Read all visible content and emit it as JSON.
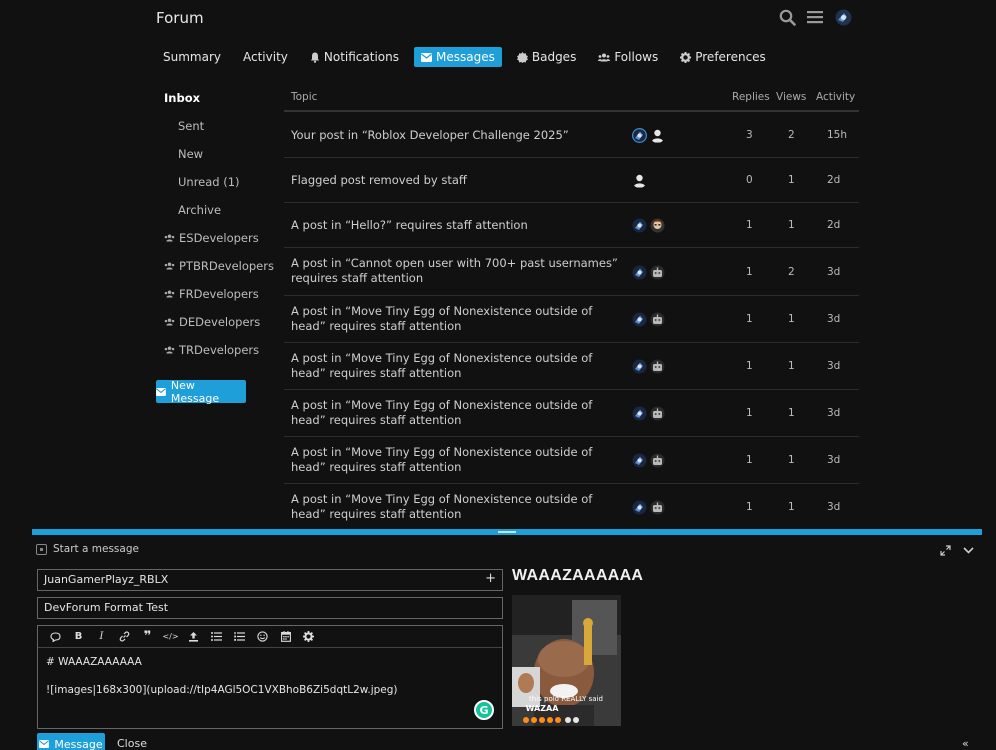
{
  "header": {
    "site_title": "Forum",
    "icons": [
      "search-icon",
      "hamburger-menu-icon",
      "user-avatar"
    ]
  },
  "user_nav": {
    "items": [
      {
        "label": "Summary",
        "icon": ""
      },
      {
        "label": "Activity",
        "icon": ""
      },
      {
        "label": "Notifications",
        "icon": "bell-icon"
      },
      {
        "label": "Messages",
        "icon": "envelope-icon",
        "active": true
      },
      {
        "label": "Badges",
        "icon": "badge-icon"
      },
      {
        "label": "Follows",
        "icon": "users-icon"
      },
      {
        "label": "Preferences",
        "icon": "gear-icon"
      }
    ]
  },
  "sidebar": {
    "inbox": "Inbox",
    "sub_items": [
      "Sent",
      "New",
      "Unread (1)",
      "Archive"
    ],
    "groups": [
      "ESDevelopers",
      "PTBRDevelopers",
      "FRDevelopers",
      "DEDevelopers",
      "TRDevelopers"
    ],
    "new_message_label": "New Message"
  },
  "topics": {
    "columns": {
      "topic": "Topic",
      "replies": "Replies",
      "views": "Views",
      "activity": "Activity"
    },
    "rows": [
      {
        "title": "Your post in “Roblox Developer Challenge 2025”",
        "replies": "3",
        "views": "2",
        "activity": "15h"
      },
      {
        "title": "Flagged post removed by staff",
        "replies": "0",
        "views": "1",
        "activity": "2d"
      },
      {
        "title": "A post in “Hello?” requires staff attention",
        "replies": "1",
        "views": "1",
        "activity": "2d"
      },
      {
        "title": "A post in “Cannot open user with 700+ past usernames” requires staff attention",
        "replies": "1",
        "views": "2",
        "activity": "3d"
      },
      {
        "title": "A post in “Move Tiny Egg of Nonexistence outside of head” requires staff attention",
        "replies": "1",
        "views": "1",
        "activity": "3d"
      },
      {
        "title": "A post in “Move Tiny Egg of Nonexistence outside of head” requires staff attention",
        "replies": "1",
        "views": "1",
        "activity": "3d"
      },
      {
        "title": "A post in “Move Tiny Egg of Nonexistence outside of head” requires staff attention",
        "replies": "1",
        "views": "1",
        "activity": "3d"
      },
      {
        "title": "A post in “Move Tiny Egg of Nonexistence outside of head” requires staff attention",
        "replies": "1",
        "views": "1",
        "activity": "3d"
      },
      {
        "title": "A post in “Move Tiny Egg of Nonexistence outside of head” requires staff attention",
        "replies": "1",
        "views": "1",
        "activity": "3d"
      }
    ]
  },
  "composer": {
    "heading": "Start a message",
    "recipient": "JuanGamerPlayz_RBLX",
    "subject": "DevForum Format Test",
    "body_line1": "# WAAAZAAAAAA",
    "body_line2": "![images|168x300](upload://tIp4AGl5OC1VXBhoB6Zi5dqtL2w.jpeg)",
    "preview_heading": "WAAAZAAAAAA",
    "preview_image_caption_1": "this polo REALLY said",
    "preview_image_caption_2": "WAZAA",
    "send_label": "Message",
    "close_label": "Close",
    "collapse_glyph": "«",
    "toolbar_icons": [
      "speech-bubble-icon",
      "bold-icon",
      "italic-icon",
      "link-icon",
      "quote-icon",
      "code-icon",
      "upload-icon",
      "bullet-list-icon",
      "numbered-list-icon",
      "emoji-icon",
      "calendar-icon",
      "gear-icon"
    ],
    "toolbar_glyphs": {
      "bold": "B",
      "italic": "I",
      "quote": "❞",
      "code": "</>"
    }
  },
  "colors": {
    "accent": "#1e9fd9",
    "background": "#111111",
    "row_border": "#2c2c2c"
  }
}
